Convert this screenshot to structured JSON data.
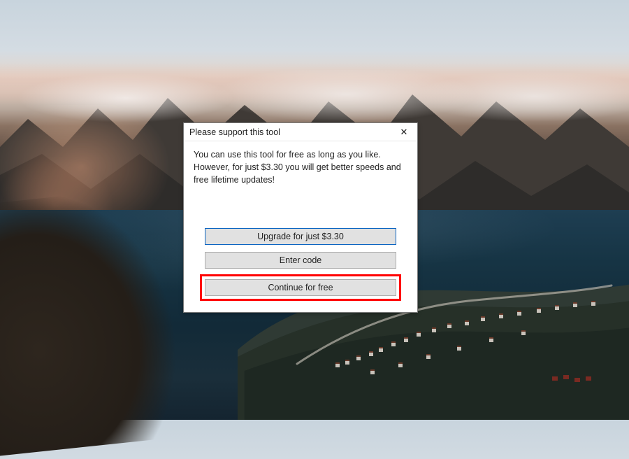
{
  "dialog": {
    "title": "Please support this tool",
    "message": "You can use this tool for free as long as you like. However, for just $3.30 you will get better speeds and free lifetime updates!",
    "buttons": {
      "upgrade": "Upgrade for just $3.30",
      "enter_code": "Enter code",
      "continue_free": "Continue for free"
    },
    "close_glyph": "✕"
  }
}
